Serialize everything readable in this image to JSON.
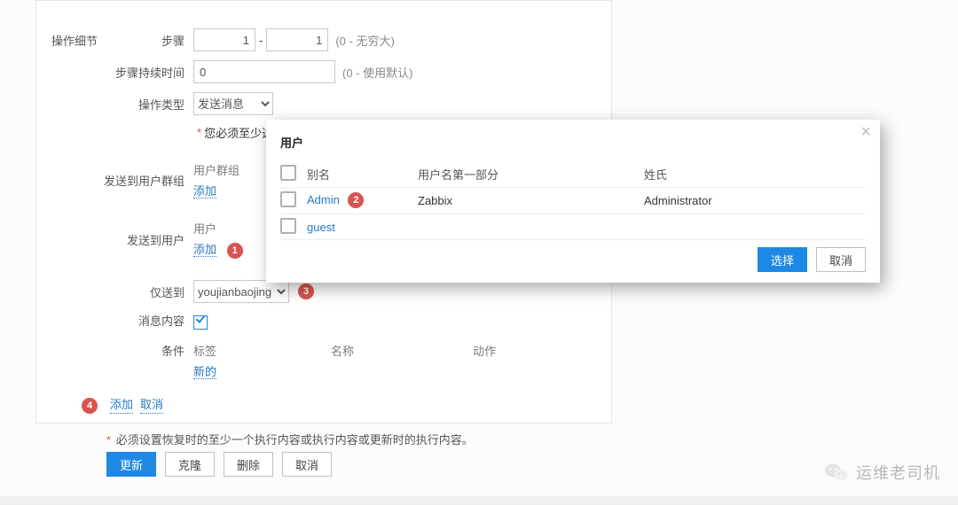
{
  "section_title": "操作细节",
  "rows": {
    "steps": {
      "label": "步骤",
      "from": "1",
      "to": "1",
      "hint": "(0 - 无穷大)"
    },
    "step_duration": {
      "label": "步骤持续时间",
      "value": "0",
      "hint": "(0 - 使用默认)"
    },
    "op_type": {
      "label": "操作类型",
      "selected": "发送消息"
    },
    "required_note": "您必须至少选",
    "send_to_user_group": {
      "label": "发送到用户群组",
      "col_header": "用户群组",
      "add": "添加"
    },
    "send_to_user": {
      "label": "发送到用户",
      "col_header": "用户",
      "add": "添加"
    },
    "send_only_to": {
      "label": "仅送到",
      "selected": "youjianbaojing"
    },
    "msg_content": {
      "label": "消息内容"
    },
    "conditions": {
      "label": "条件",
      "cols": {
        "tag": "标签",
        "name": "名称",
        "action": "动作"
      },
      "new": "新的"
    },
    "footer_actions": {
      "add": "添加",
      "cancel": "取消"
    }
  },
  "modal": {
    "title": "用户",
    "cols": {
      "alias": "别名",
      "first": "用户名第一部分",
      "surname": "姓氏"
    },
    "rows": [
      {
        "alias": "Admin",
        "first": "Zabbix",
        "surname": "Administrator"
      },
      {
        "alias": "guest",
        "first": "",
        "surname": ""
      }
    ],
    "select": "选择",
    "cancel": "取消"
  },
  "annotations": {
    "b1": "1",
    "b2": "2",
    "b3": "3",
    "b4": "4"
  },
  "footer_note": "必须设置恢复时的至少一个执行内容或执行内容或更新时的执行内容。",
  "buttons": {
    "update": "更新",
    "clone": "克隆",
    "delete": "删除",
    "cancel": "取消"
  },
  "brand": "运维老司机"
}
